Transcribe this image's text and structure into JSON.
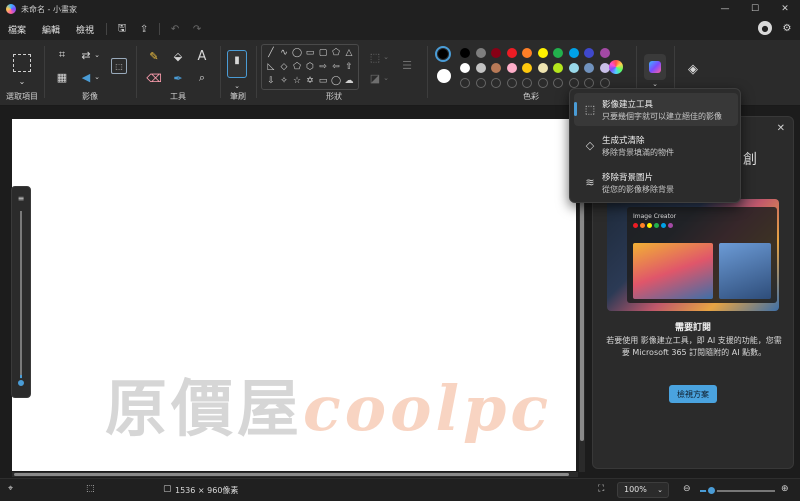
{
  "window": {
    "title": "未命名 - 小畫家",
    "minimize": "—",
    "maximize": "☐",
    "close": "✕"
  },
  "menu": {
    "items": [
      "檔案",
      "編輯",
      "檢視"
    ]
  },
  "ribbon": {
    "groups": {
      "selection": "選取項目",
      "image": "影像",
      "tools": "工具",
      "brushes": "筆刷",
      "shapes": "形狀",
      "colors": "色彩"
    },
    "colors": {
      "current_primary": "#000000",
      "current_secondary": "#ffffff",
      "palette_row1": [
        "#000000",
        "#7f7f7f",
        "#880015",
        "#ed1c24",
        "#ff7f27",
        "#fff200",
        "#22b14c",
        "#00a2e8",
        "#3f48cc",
        "#a349a4",
        "#ff0000",
        "#7b4cff"
      ],
      "palette_row2": [
        "#ffffff",
        "#c3c3c3",
        "#b97a57",
        "#ffaec9",
        "#ffc90e",
        "#efe4b0",
        "#b5e61d",
        "#99d9ea",
        "#7092be",
        "#c8bfe7"
      ]
    }
  },
  "flyout": {
    "items": [
      {
        "title": "影像建立工具",
        "subtitle": "只要幾個字就可以建立絕佳的影像",
        "icon": "image-sparkle-icon"
      },
      {
        "title": "生成式清除",
        "subtitle": "移除背景填滿的物件",
        "icon": "eraser-sparkle-icon"
      },
      {
        "title": "移除背景圖片",
        "subtitle": "從您的影像移除背景",
        "icon": "remove-background-icon"
      }
    ]
  },
  "panel": {
    "top_heading": "創",
    "mock_title": "Image Creator",
    "heading": "需要訂閱",
    "body": "若要使用 影像建立工具，即 AI 支援的功能，您需要 Microsoft 365 訂閱隨附的 AI 點數。",
    "button": "檢視方案"
  },
  "status": {
    "canvas_size": "1536 × 960像素",
    "zoom": "100%",
    "zoom_percent": 15
  },
  "watermark": {
    "text": "原價屋",
    "accent": "coolpc"
  }
}
